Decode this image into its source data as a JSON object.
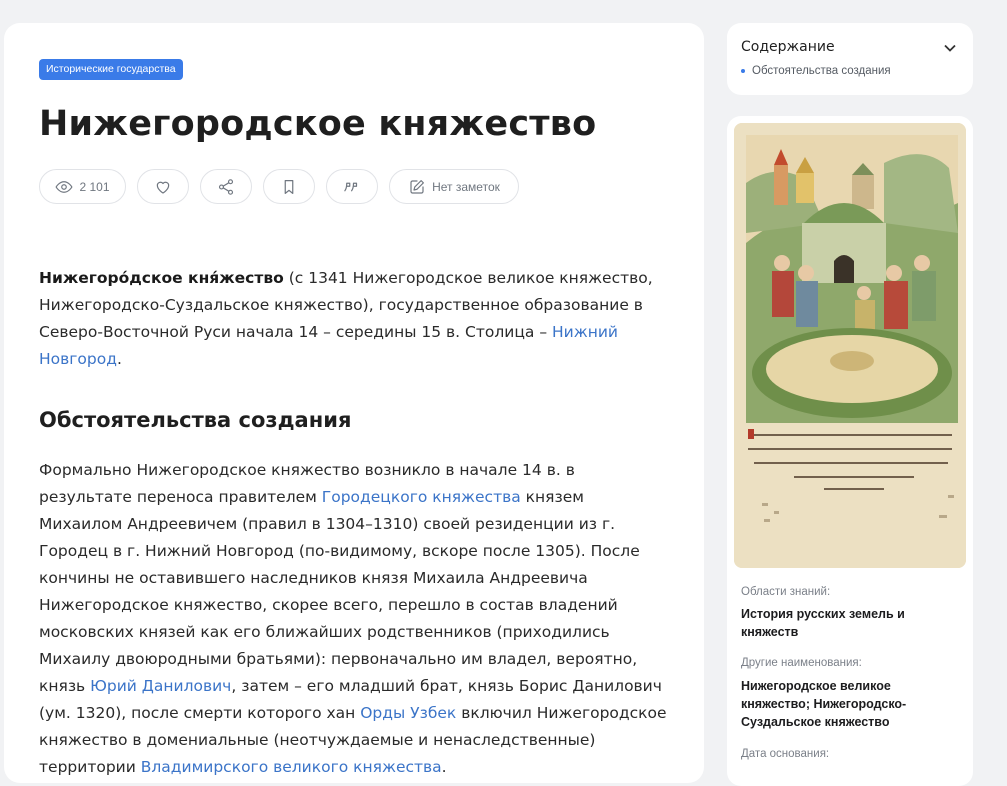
{
  "article": {
    "badge": "Исторические государства",
    "title": "Нижегородское княжество",
    "actions": {
      "views": "2 101",
      "notes": "Нет заметок"
    },
    "intro": {
      "term": "Нижегоро́дское кня́жество",
      "text1": " (с 1341 Нижегородское великое княжество, Нижегородско-Суздальское княжество), государственное образование в Северо-Восточной Руси начала 14 – середины 15 в. Столица – ",
      "link1": "Нижний Новгород",
      "text2": "."
    },
    "section_title": "Обстоятельства создания",
    "paragraph": {
      "t1": "Формально Нижегородское княжество возникло в начале 14 в. в результате переноса правителем ",
      "l1": "Городецкого княжества",
      "t2": " князем Михаилом Андреевичем (правил в 1304–1310) своей резиденции из г. Городец в г. Нижний Новгород (по-видимому, вскоре после 1305). После кончины не оставившего наследников князя Михаила Андреевича Нижегородское княжество, скорее всего, перешло в состав владений московских князей как его ближайших родственников (приходились Михаилу двоюродными братьями): первоначально им владел, вероятно, князь ",
      "l2": "Юрий Данилович",
      "t3": ", затем – его младший брат, князь Борис Данилович (ум. 1320), после смерти которого хан ",
      "l3": "Орды Узбек",
      "t4": " включил Нижегородское княжество в домениальные (неотчуждаемые и ненаследственные) территории ",
      "l4": "Владимирского великого княжества",
      "t5": "."
    }
  },
  "toc": {
    "title": "Содержание",
    "items": [
      "Обстоятельства создания"
    ]
  },
  "sidebar": {
    "fields": [
      {
        "label": "Области знаний:",
        "value": "История русских земель и княжеств"
      },
      {
        "label": "Другие наименования:",
        "value": "Нижегородское великое княжество; Нижегородско-Суздальское княжество"
      },
      {
        "label": "Дата основания:",
        "value": ""
      }
    ]
  },
  "colors": {
    "accent": "#3a7be8",
    "link": "#3b74c8",
    "card": "#ffffff",
    "page_bg": "#f1f2f4"
  }
}
